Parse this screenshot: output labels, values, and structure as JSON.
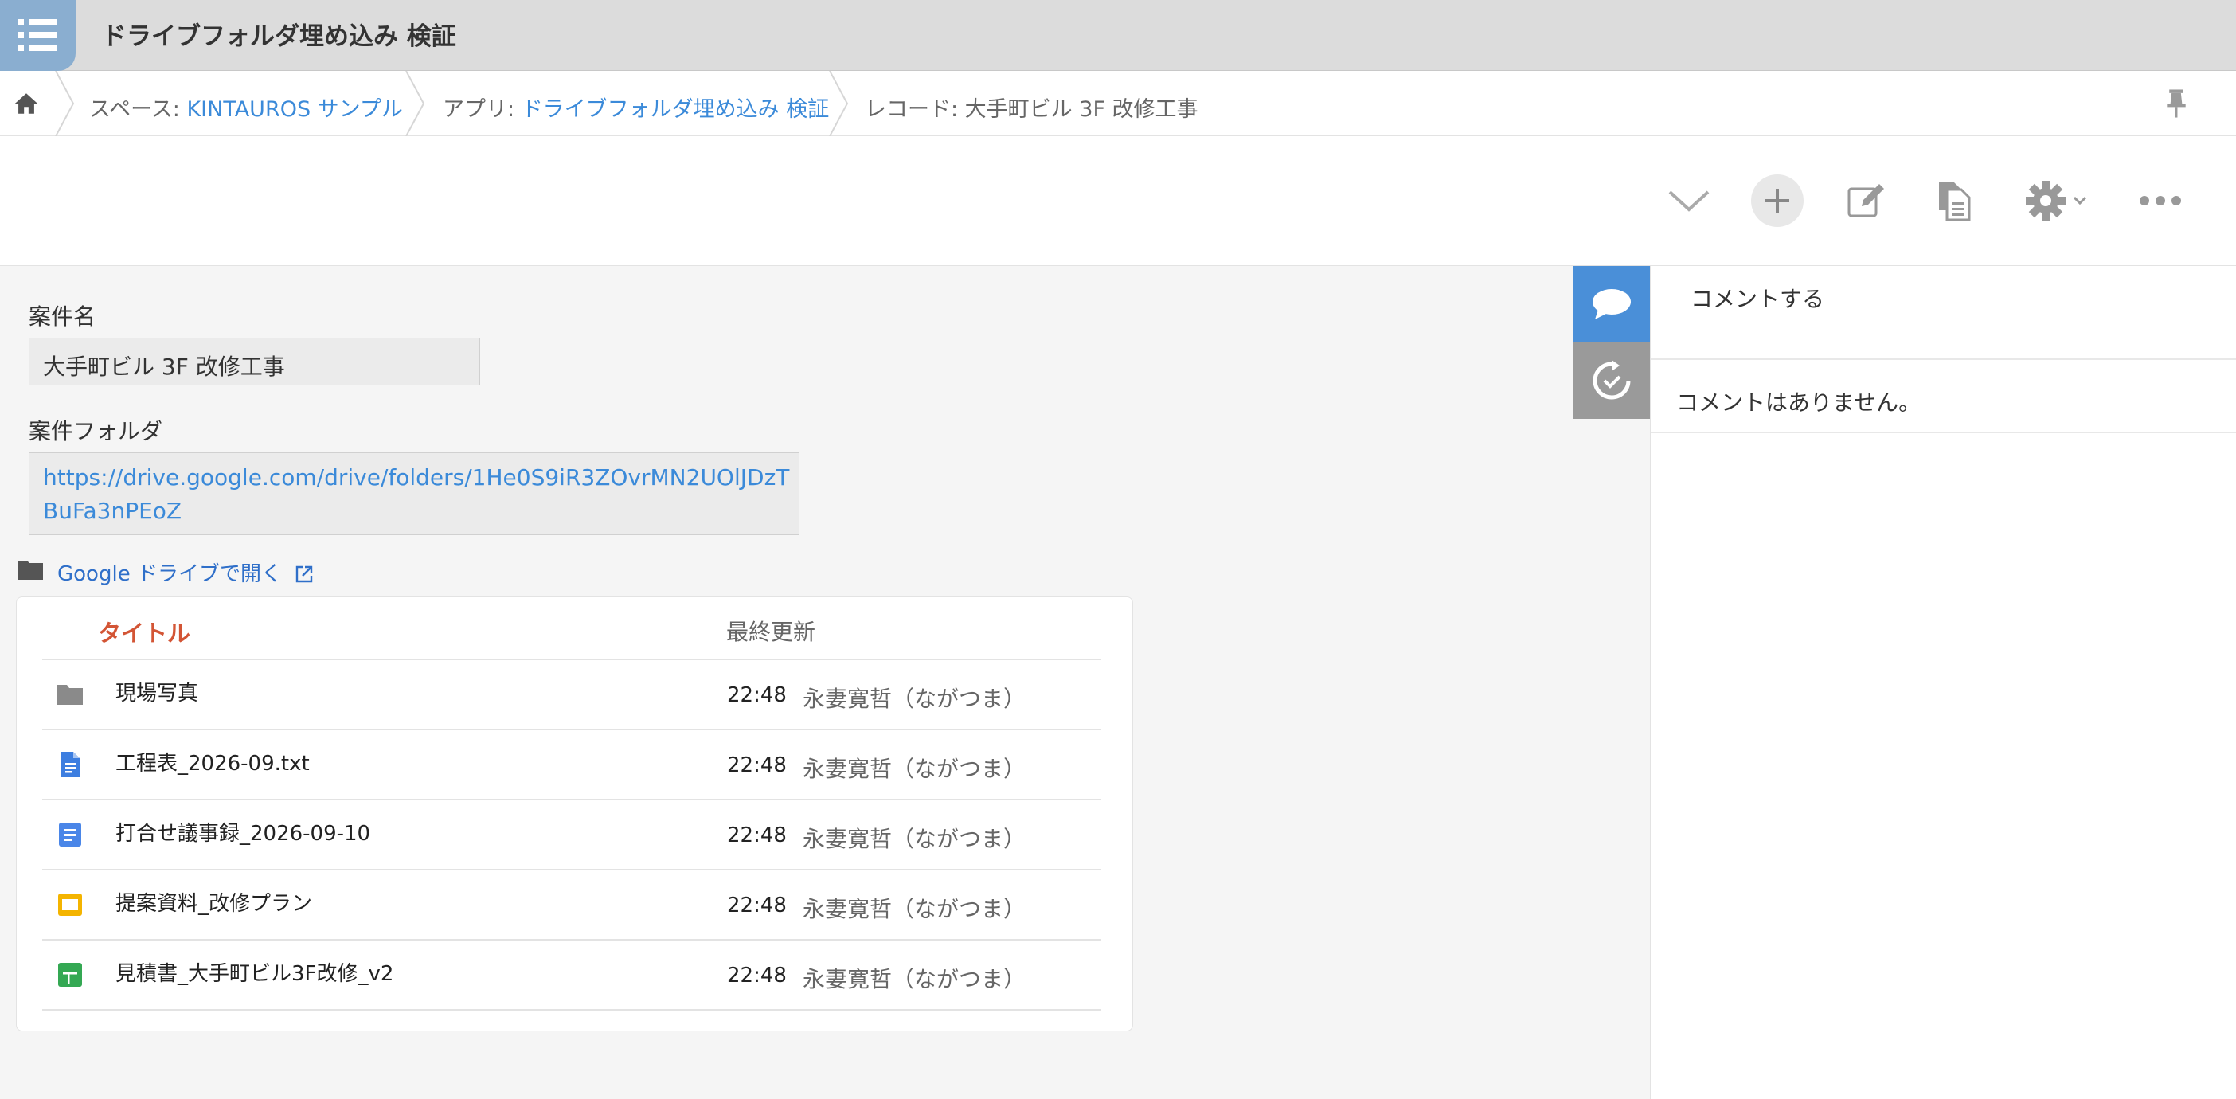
{
  "header": {
    "app_title": "ドライブフォルダ埋め込み 検証",
    "app_icon": "list-icon"
  },
  "breadcrumb": {
    "space_prefix": "スペース: ",
    "space_name": "KINTAUROS サンプル",
    "app_prefix": "アプリ: ",
    "app_name": "ドライブフォルダ埋め込み 検証",
    "record_label": "レコード: 大手町ビル 3F 改修工事"
  },
  "toolbar": {
    "icons": [
      "chevron-down-icon",
      "plus-icon",
      "edit-icon",
      "copy-icon",
      "gear-icon",
      "more-icon"
    ]
  },
  "record": {
    "name_label": "案件名",
    "name_value": "大手町ビル 3F 改修工事",
    "folder_label": "案件フォルダ",
    "folder_url": "https://drive.google.com/drive/folders/1He0S9iR3ZOvrMN2UOlJDzTBuFa3nPEoZ",
    "open_link": "Google ドライブで開く"
  },
  "files": {
    "columns": {
      "title": "タイトル",
      "updated": "最終更新"
    },
    "rows": [
      {
        "name": "現場写真",
        "time": "22:48",
        "user": "永妻寛哲（ながつま）",
        "type": "folder"
      },
      {
        "name": "工程表_2026-09.txt",
        "time": "22:48",
        "user": "永妻寛哲（ながつま）",
        "type": "text"
      },
      {
        "name": "打合せ議事録_2026-09-10",
        "time": "22:48",
        "user": "永妻寛哲（ながつま）",
        "type": "docs"
      },
      {
        "name": "提案資料_改修プラン",
        "time": "22:48",
        "user": "永妻寛哲（ながつま）",
        "type": "slides"
      },
      {
        "name": "見積書_大手町ビル3F改修_v2",
        "time": "22:48",
        "user": "永妻寛哲（ながつま）",
        "type": "sheets"
      }
    ]
  },
  "sidebar": {
    "comment_placeholder": "コメントする",
    "no_comments": "コメントはありません。"
  },
  "colors": {
    "header_bg": "#dcdcdc",
    "link": "#3b8ad9",
    "title_column": "#d35535",
    "comment_tab": "#4a8fd8",
    "history_tab": "#9a9a9a"
  }
}
